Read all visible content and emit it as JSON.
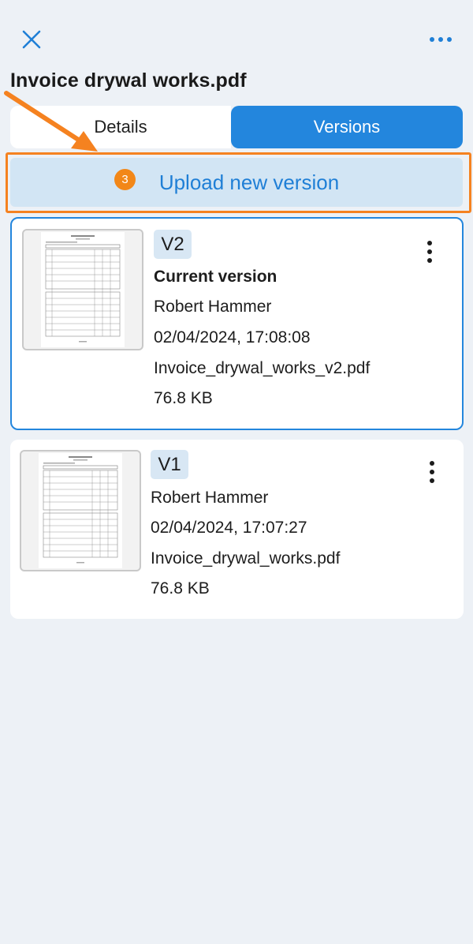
{
  "header": {
    "title": "Invoice drywal works.pdf",
    "close_icon": "close-icon",
    "more_icon": "more-horizontal-icon"
  },
  "tabs": [
    {
      "label": "Details",
      "active": false
    },
    {
      "label": "Versions",
      "active": true
    }
  ],
  "upload": {
    "label": "Upload new version",
    "step_number": "3"
  },
  "versions": [
    {
      "badge": "V2",
      "status": "Current version",
      "author": "Robert Hammer",
      "timestamp": "02/04/2024, 17:08:08",
      "filename": "Invoice_drywal_works_v2.pdf",
      "size": "76.8 KB"
    },
    {
      "badge": "V1",
      "author": "Robert Hammer",
      "timestamp": "02/04/2024, 17:07:27",
      "filename": "Invoice_drywal_works.pdf",
      "size": "76.8 KB"
    }
  ],
  "colors": {
    "accent": "#2386dd",
    "highlight": "#f58220",
    "background": "#edf1f6"
  }
}
